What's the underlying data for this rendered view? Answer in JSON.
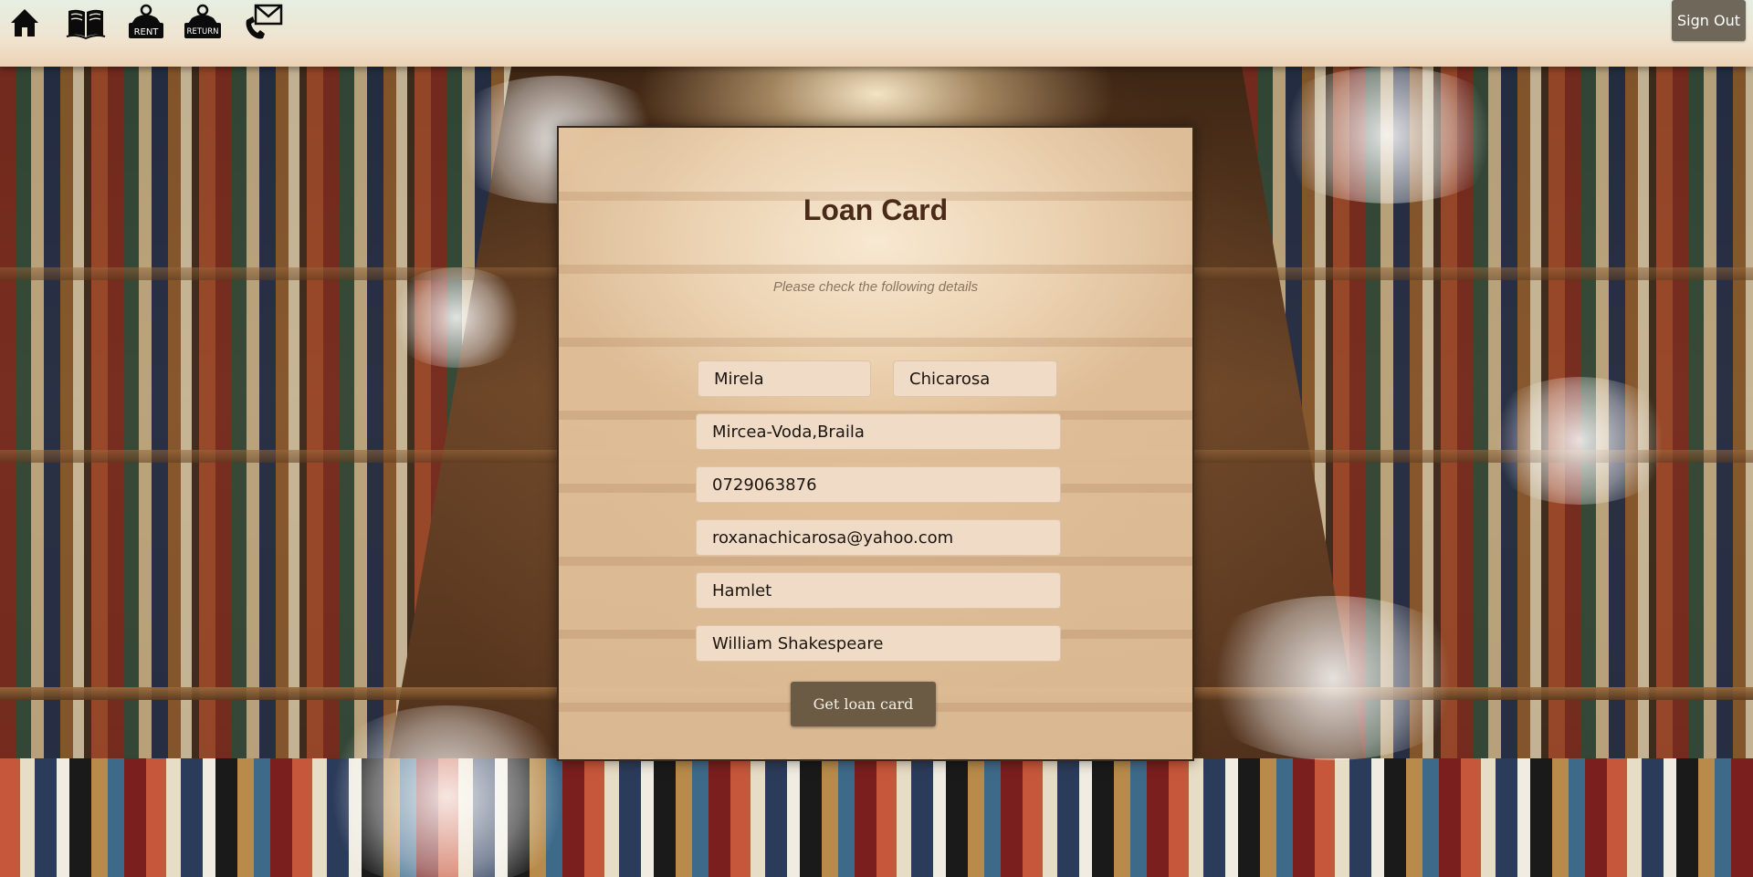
{
  "nav": {
    "icons": [
      {
        "name": "home-icon"
      },
      {
        "name": "books-icon"
      },
      {
        "name": "rent-icon",
        "label": "RENT"
      },
      {
        "name": "return-icon",
        "label": "RETURN"
      },
      {
        "name": "contact-icon"
      }
    ],
    "sign_out_label": "Sign Out"
  },
  "card": {
    "title": "Loan Card",
    "subtitle": "Please check the following details",
    "fields": {
      "first_name": "Mirela",
      "last_name": "Chicarosa",
      "address": "Mircea-Voda,Braila",
      "phone": "0729063876",
      "email": "roxanachicarosa@yahoo.com",
      "book_title": "Hamlet",
      "book_author": "William Shakespeare"
    },
    "submit_label": "Get loan card"
  }
}
